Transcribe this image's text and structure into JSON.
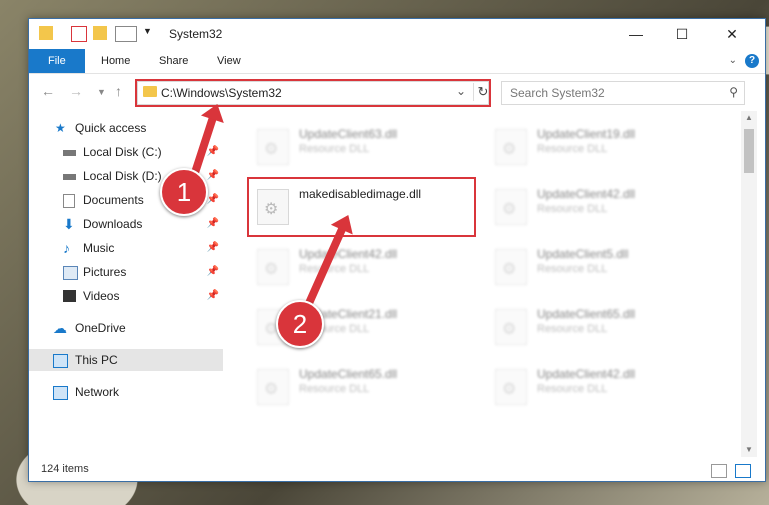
{
  "window": {
    "title": "System32"
  },
  "ribbon": {
    "tabs": [
      "File",
      "Home",
      "Share",
      "View"
    ],
    "help": "?"
  },
  "address": {
    "path": "C:\\Windows\\System32",
    "search_placeholder": "Search System32"
  },
  "sidebar": {
    "items": [
      {
        "label": "Quick access"
      },
      {
        "label": "Local Disk (C:)"
      },
      {
        "label": "Local Disk (D:)"
      },
      {
        "label": "Documents"
      },
      {
        "label": "Downloads"
      },
      {
        "label": "Music"
      },
      {
        "label": "Pictures"
      },
      {
        "label": "Videos"
      },
      {
        "label": "OneDrive"
      },
      {
        "label": "This PC"
      },
      {
        "label": "Network"
      }
    ]
  },
  "files": [
    {
      "name": "UpdateClient63.dll",
      "type": "Resource DLL"
    },
    {
      "name": "UpdateClient19.dll",
      "type": "Resource DLL"
    },
    {
      "name": "makedisabledimage.dll",
      "type": ""
    },
    {
      "name": "UpdateClient42.dll",
      "type": "Resource DLL"
    },
    {
      "name": "UpdateClient42.dll",
      "type": "Resource DLL"
    },
    {
      "name": "UpdateClient5.dll",
      "type": "Resource DLL"
    },
    {
      "name": "UpdateClient21.dll",
      "type": "Resource DLL"
    },
    {
      "name": "UpdateClient65.dll",
      "type": "Resource DLL"
    },
    {
      "name": "UpdateClient65.dll",
      "type": "Resource DLL"
    },
    {
      "name": "UpdateClient42.dll",
      "type": "Resource DLL"
    }
  ],
  "status": {
    "count": "124 items"
  },
  "callouts": [
    "1",
    "2"
  ],
  "colors": {
    "accent": "#1979ca",
    "highlight": "#d9353b",
    "folder": "#f3c64b"
  }
}
